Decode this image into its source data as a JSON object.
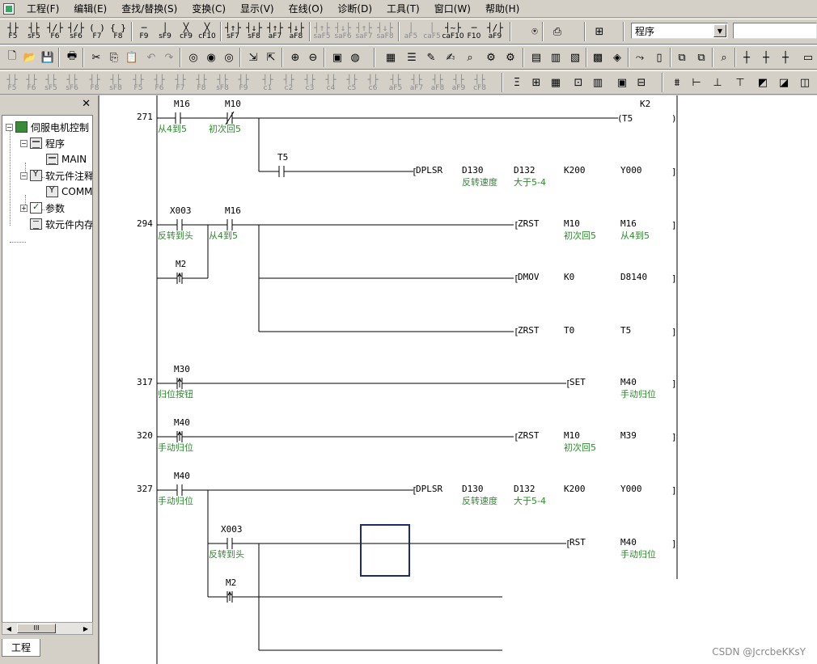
{
  "menu": [
    "工程(F)",
    "编辑(E)",
    "查找/替换(S)",
    "变换(C)",
    "显示(V)",
    "在线(O)",
    "诊断(D)",
    "工具(T)",
    "窗口(W)",
    "帮助(H)"
  ],
  "toolbar_row1": {
    "ladder_keys": [
      {
        "glyph": "┤├",
        "key": "F5"
      },
      {
        "glyph": "┤├",
        "key": "sF5"
      },
      {
        "glyph": "┤/├",
        "key": "F6"
      },
      {
        "glyph": "┤/├",
        "key": "sF6"
      },
      {
        "glyph": "( )",
        "key": "F7"
      },
      {
        "glyph": "{ }",
        "key": "F8"
      },
      {
        "glyph": "─",
        "key": "F9"
      },
      {
        "glyph": "│",
        "key": "sF9"
      },
      {
        "glyph": "╳",
        "key": "cF9"
      },
      {
        "glyph": "╳",
        "key": "cF10"
      },
      {
        "glyph": "┤↑├",
        "key": "sF7"
      },
      {
        "glyph": "┤↓├",
        "key": "sF8"
      },
      {
        "glyph": "┤↑├",
        "key": "aF7"
      },
      {
        "glyph": "┤↓├",
        "key": "aF8"
      },
      {
        "glyph": "┤↑├",
        "key": "saF5"
      },
      {
        "glyph": "┤↓├",
        "key": "saF6"
      },
      {
        "glyph": "┤↑├",
        "key": "saF7"
      },
      {
        "glyph": "┤↓├",
        "key": "saF8"
      },
      {
        "glyph": "│",
        "key": "aF5"
      },
      {
        "glyph": "│",
        "key": "caF5"
      },
      {
        "glyph": "┤~├",
        "key": "caF10"
      },
      {
        "glyph": "─",
        "key": "F10"
      },
      {
        "glyph": "┤/├",
        "key": "aF9"
      }
    ],
    "program_select": "程序"
  },
  "toolbar_row3_keys": [
    "F5",
    "F6",
    "sF5",
    "sF6",
    "F8",
    "sF8",
    "F5",
    "F6",
    "F7",
    "F8",
    "sF8",
    "F9",
    "c1",
    "c2",
    "c3",
    "c4",
    "c5",
    "c6",
    "aF5",
    "aF7",
    "aF8",
    "aF9",
    "cF8",
    "saF8"
  ],
  "nav": {
    "tab": "工程",
    "tree": [
      {
        "label": "伺服电机控制",
        "level": 0,
        "icon": "project-folder"
      },
      {
        "label": "程序",
        "level": 1,
        "icon": "program"
      },
      {
        "label": "MAIN",
        "level": 2,
        "icon": "program"
      },
      {
        "label": "软元件注释",
        "level": 1,
        "icon": "device-comment"
      },
      {
        "label": "COMMENT",
        "level": 2,
        "icon": "device-comment"
      },
      {
        "label": "参数",
        "level": 1,
        "icon": "parameter"
      },
      {
        "label": "软元件内存",
        "level": 1,
        "icon": "device-memory"
      }
    ],
    "scroll_label": "III"
  },
  "ladder": {
    "rungs": [
      {
        "step": "271"
      },
      {
        "step": "294"
      },
      {
        "step": "317"
      },
      {
        "step": "320"
      },
      {
        "step": "327"
      }
    ],
    "contacts": [
      {
        "dev": "M16",
        "comment": "从4到5"
      },
      {
        "dev": "M10",
        "comment": "初次回5"
      },
      {
        "dev": "T5",
        "comment": ""
      },
      {
        "dev": "X003",
        "comment": "反转到头"
      },
      {
        "dev": "M16",
        "comment": "从4到5"
      },
      {
        "dev": "M2",
        "comment": ""
      },
      {
        "dev": "M30",
        "comment": "归位按钮"
      },
      {
        "dev": "M40",
        "comment": "手动归位"
      },
      {
        "dev": "M40",
        "comment": "手动归位"
      },
      {
        "dev": "X003",
        "comment": "反转到头"
      },
      {
        "dev": "M2",
        "comment": ""
      }
    ],
    "coil_t5": {
      "name": "T5",
      "preset": "K2"
    },
    "instructions": [
      {
        "op": "DPLSR",
        "args": [
          {
            "v": "D130",
            "c": "反转速度"
          },
          {
            "v": "D132",
            "c": "大于5-4"
          },
          {
            "v": "K200",
            "c": ""
          },
          {
            "v": "Y000",
            "c": ""
          }
        ]
      },
      {
        "op": "ZRST",
        "args": [
          {
            "v": "M10",
            "c": "初次回5"
          },
          {
            "v": "M16",
            "c": "从4到5"
          }
        ]
      },
      {
        "op": "DMOV",
        "args": [
          {
            "v": "K0",
            "c": ""
          },
          {
            "v": "D8140",
            "c": ""
          }
        ]
      },
      {
        "op": "ZRST",
        "args": [
          {
            "v": "T0",
            "c": ""
          },
          {
            "v": "T5",
            "c": ""
          }
        ]
      },
      {
        "op": "SET",
        "args": [
          {
            "v": "M40",
            "c": "手动归位"
          }
        ]
      },
      {
        "op": "ZRST",
        "args": [
          {
            "v": "M10",
            "c": "初次回5"
          },
          {
            "v": "M39",
            "c": ""
          }
        ]
      },
      {
        "op": "DPLSR",
        "args": [
          {
            "v": "D130",
            "c": "反转速度"
          },
          {
            "v": "D132",
            "c": "大于5-4"
          },
          {
            "v": "K200",
            "c": ""
          },
          {
            "v": "Y000",
            "c": ""
          }
        ]
      },
      {
        "op": "RST",
        "args": [
          {
            "v": "M40",
            "c": "手动归位"
          }
        ]
      }
    ]
  },
  "watermark": "CSDN @JcrcbeKKsY"
}
